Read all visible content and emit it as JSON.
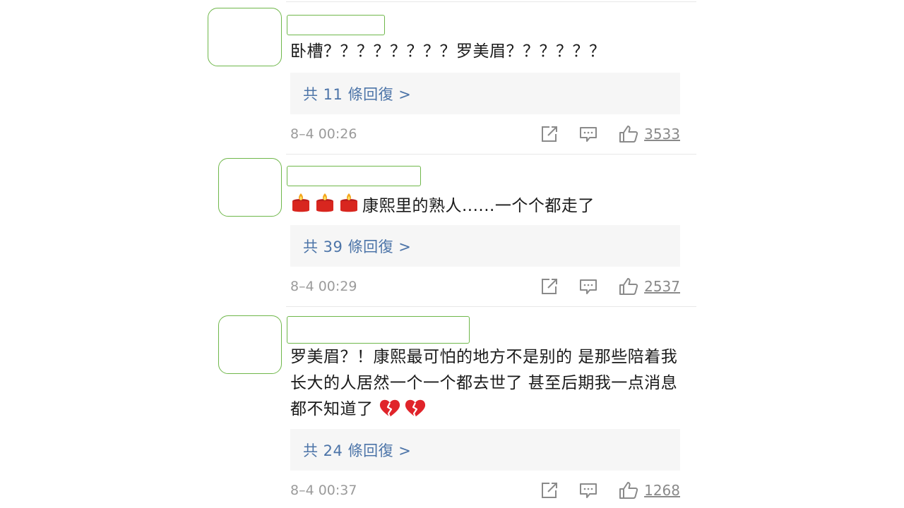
{
  "comments": [
    {
      "text": "卧槽？？？？？？？？罗美眉？？？？？？",
      "emojis": [],
      "reply_label": "共 11 條回復 >",
      "timestamp": "8–4 00:26",
      "likes": "3533"
    },
    {
      "text": "康熙里的熟人......一个个都走了",
      "emojis": [
        "candle",
        "candle",
        "candle"
      ],
      "reply_label": "共 39 條回復 >",
      "timestamp": "8–4 00:29",
      "likes": "2537"
    },
    {
      "text": "罗美眉？！康熙最可怕的地方不是别的 是那些陪着我长大的人居然一个一个都去世了 甚至后期我一点消息都不知道了",
      "emojis_after": [
        "broken-heart",
        "broken-heart"
      ],
      "reply_label": "共 24 條回復 >",
      "timestamp": "8–4 00:37",
      "likes": "1268"
    }
  ],
  "colors": {
    "placeholder_outline": "#6fb74a",
    "reply_link": "#4c74a8",
    "reply_bg": "#f6f6f6",
    "meta_text": "#9b9b9b"
  }
}
